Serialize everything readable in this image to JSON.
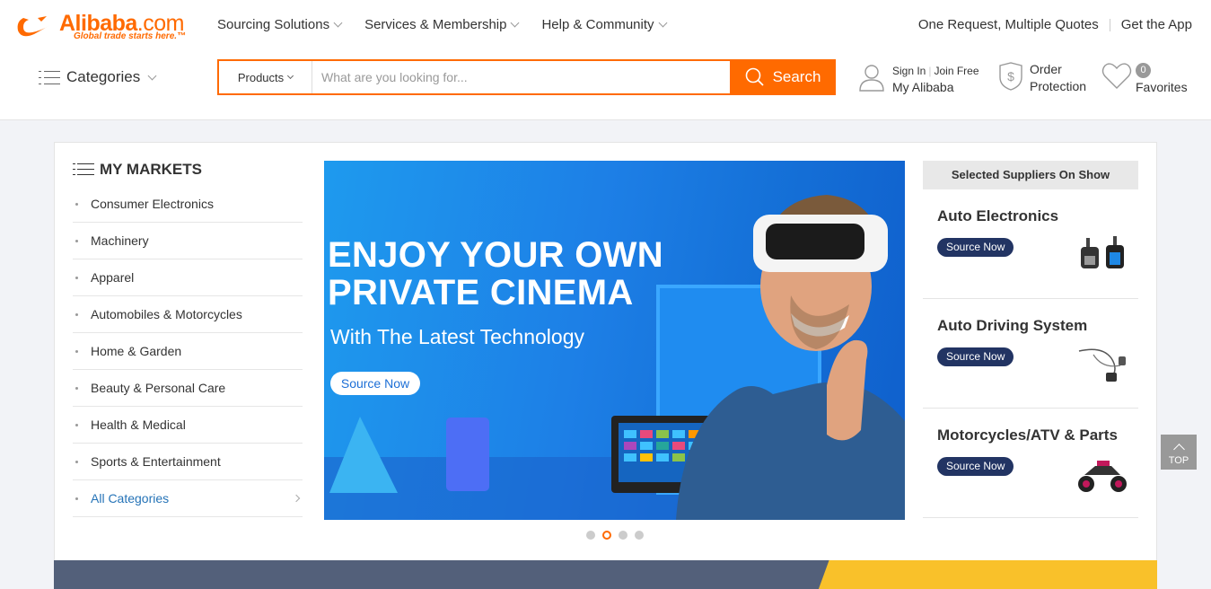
{
  "brand": {
    "name": "Alibaba",
    "suffix": ".com",
    "tagline": "Global trade starts here.™",
    "color": "#ff6a00"
  },
  "topnav": {
    "items": [
      "Sourcing Solutions",
      "Services & Membership",
      "Help & Community"
    ],
    "right_links": [
      "One Request, Multiple Quotes",
      "Get the App"
    ]
  },
  "categories_label": "Categories",
  "search": {
    "scope": "Products",
    "placeholder": "What are you looking for...",
    "button": "Search"
  },
  "account": {
    "sign_in": "Sign In",
    "join": "Join Free",
    "my": "My Alibaba"
  },
  "order_protection": {
    "line1": "Order",
    "line2": "Protection"
  },
  "favorites": {
    "count": "0",
    "label": "Favorites"
  },
  "markets": {
    "title": "MY MARKETS",
    "items": [
      "Consumer Electronics",
      "Machinery",
      "Apparel",
      "Automobiles & Motorcycles",
      "Home & Garden",
      "Beauty & Personal Care",
      "Health & Medical",
      "Sports & Entertainment"
    ],
    "all": "All Categories"
  },
  "banner": {
    "headline1": "ENJOY YOUR OWN",
    "headline2": "PRIVATE CINEMA",
    "subtitle": "With The Latest Technology",
    "button": "Source Now",
    "slide_count": 4,
    "active_slide": 2
  },
  "suppliers": {
    "title": "Selected Suppliers On Show",
    "cards": [
      {
        "name": "Auto Electronics",
        "button": "Source Now",
        "image_icon": "dashcam-icon"
      },
      {
        "name": "Auto Driving System",
        "button": "Source Now",
        "image_icon": "wiring-icon"
      },
      {
        "name": "Motorcycles/ATV & Parts",
        "button": "Source Now",
        "image_icon": "atv-icon"
      }
    ]
  },
  "back_to_top": "TOP"
}
